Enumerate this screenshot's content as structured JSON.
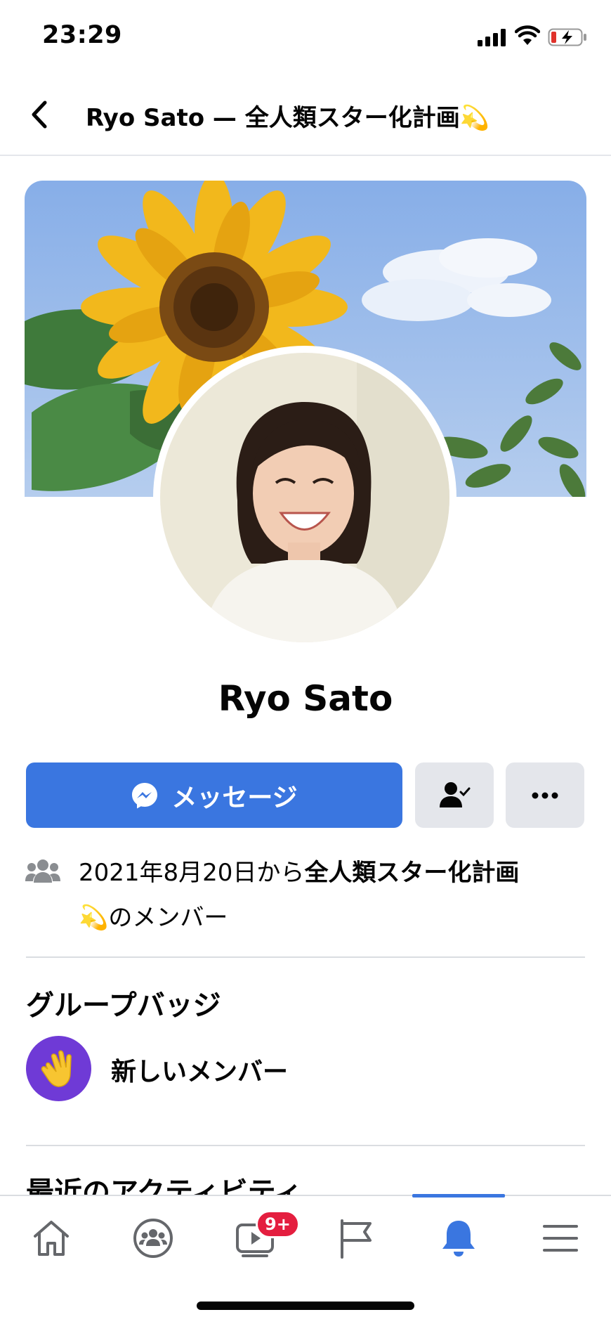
{
  "status_bar": {
    "time": "23:29"
  },
  "header": {
    "title": "Ryo Sato — 全人類スター化計画💫"
  },
  "profile": {
    "name": "Ryo Sato",
    "message_button": "メッセージ"
  },
  "membership": {
    "prefix": "2021年8月20日から",
    "group_name": "全人類スター化計画",
    "suffix": "💫のメンバー"
  },
  "badges": {
    "title": "グループバッジ",
    "items": [
      {
        "label": "新しいメンバー",
        "emoji": "👋",
        "color": "#6f3ad6"
      }
    ]
  },
  "activity": {
    "title": "最近のアクティビティ"
  },
  "tab_bar": {
    "tabs": [
      "home-icon",
      "groups-icon",
      "video-icon",
      "pages-flag-icon",
      "notifications-bell-icon",
      "menu-icon"
    ],
    "active_tab": "notifications-bell-icon",
    "video_badge": "9+"
  },
  "colors": {
    "accent": "#3a76e0",
    "badge_red": "#e41e3f",
    "badge_purple": "#6f3ad6"
  }
}
